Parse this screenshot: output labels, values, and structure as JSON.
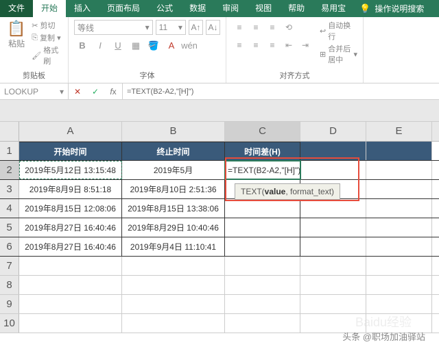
{
  "menubar": {
    "tabs": [
      "文件",
      "开始",
      "插入",
      "页面布局",
      "公式",
      "数据",
      "审阅",
      "视图",
      "帮助",
      "易用宝"
    ],
    "search": "操作说明搜索"
  },
  "ribbon": {
    "clipboard": {
      "paste": "粘贴",
      "cut": "剪切",
      "copy": "复制",
      "format": "格式刷",
      "label": "剪贴板"
    },
    "font": {
      "name": "等线",
      "size": "11",
      "label": "字体"
    },
    "align": {
      "wrap": "自动换行",
      "merge": "合并后居中",
      "label": "对齐方式"
    }
  },
  "formula_bar": {
    "name": "LOOKUP",
    "formula": "=TEXT(B2-A2,\"[H]\")"
  },
  "cols": [
    "A",
    "B",
    "C",
    "D",
    "E"
  ],
  "rows": [
    "1",
    "2",
    "3",
    "4",
    "5",
    "6",
    "7",
    "8",
    "9",
    "10"
  ],
  "headers": {
    "a": "开始时间",
    "b": "终止时间",
    "c": "时间差(H)"
  },
  "data": [
    {
      "a": "2019年5月12日 13:15:48",
      "b": "2019年5月",
      "c": "=TEXT(B2-A2,\"[H]\")"
    },
    {
      "a": "2019年8月9日 8:51:18",
      "b": "2019年8月10日 2:51:36",
      "c": ""
    },
    {
      "a": "2019年8月15日 12:08:06",
      "b": "2019年8月15日 13:38:06",
      "c": ""
    },
    {
      "a": "2019年8月27日 16:40:46",
      "b": "2019年8月29日 10:40:46",
      "c": ""
    },
    {
      "a": "2019年8月27日 16:40:46",
      "b": "2019年9月4日 11:10:41",
      "c": ""
    }
  ],
  "tooltip": {
    "func": "TEXT",
    "args": "(value, format_text)"
  },
  "attrib": "头条 @职场加油驿站",
  "watermark": "Baidu经验"
}
